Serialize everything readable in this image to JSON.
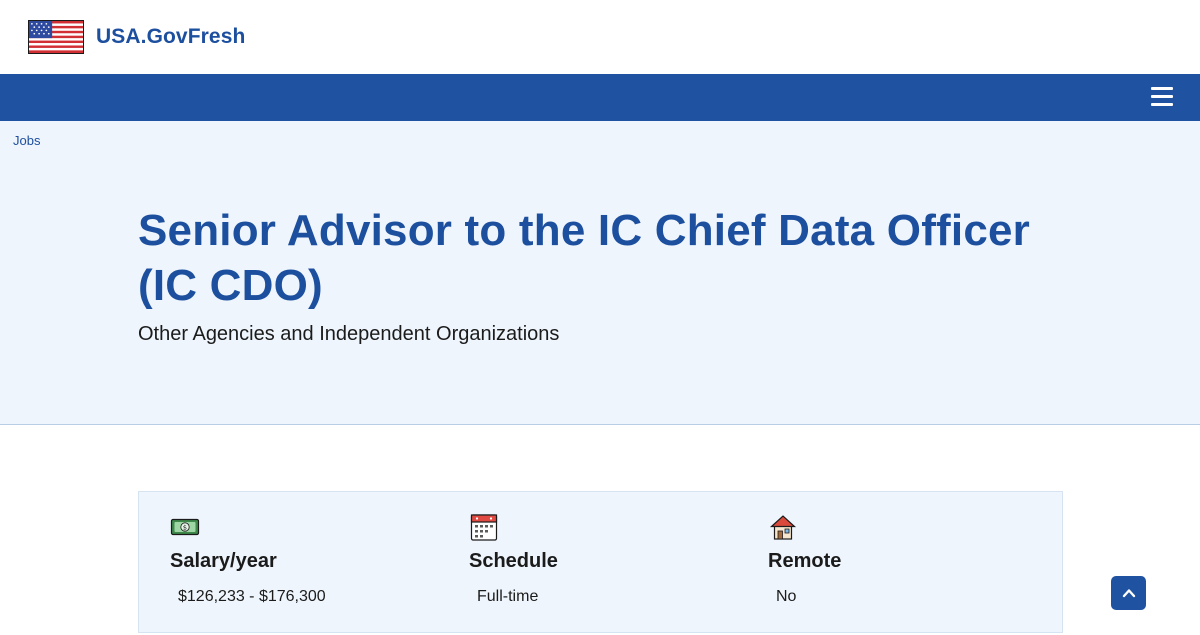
{
  "site": {
    "name": "USA.GovFresh",
    "logo_icon": "us-flag-icon",
    "menu_icon": "hamburger-menu-icon"
  },
  "breadcrumb": {
    "label": "Jobs"
  },
  "job": {
    "title": "Senior Advisor to the IC Chief Data Officer (IC CDO)",
    "agency": "Other Agencies and Independent Organizations"
  },
  "details": [
    {
      "icon": "money-icon",
      "label": "Salary/year",
      "value": "$126,233 - $176,300"
    },
    {
      "icon": "calendar-icon",
      "label": "Schedule",
      "value": "Full-time"
    },
    {
      "icon": "house-icon",
      "label": "Remote",
      "value": "No"
    }
  ],
  "back_to_top": {
    "icon": "chevron-up-icon"
  },
  "colors": {
    "primary": "#1f52a0",
    "title_text": "#1d4f9f",
    "hero_bg": "#eef5fc"
  }
}
